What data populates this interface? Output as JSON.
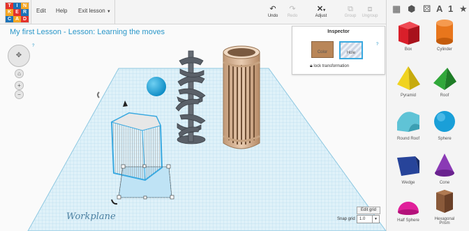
{
  "logo": {
    "letters": [
      "T",
      "I",
      "N",
      "K",
      "E",
      "R",
      "C",
      "A",
      "D"
    ]
  },
  "menu": {
    "edit": "Edit",
    "help": "Help",
    "exit_lesson": "Exit lesson"
  },
  "toolbar": {
    "undo": "Undo",
    "redo": "Redo",
    "adjust": "Adjust",
    "group": "Group",
    "ungroup": "Ungroup"
  },
  "lesson_title": "My first Lesson - Lesson: Learning the moves",
  "inspector": {
    "title": "Inspector",
    "color_label": "Color",
    "hole_label": "Hole",
    "lock_label": "lock transformation",
    "help": "?"
  },
  "view_controls": {
    "help": "?"
  },
  "sidebar_top": {
    "text_icon": "A",
    "number_icon": "1",
    "star_icon": "★"
  },
  "shapes": [
    {
      "label": "Box",
      "icon": "box-icon",
      "color": "#d91f2a"
    },
    {
      "label": "Cylinder",
      "icon": "cylinder-icon",
      "color": "#e8761c"
    },
    {
      "label": "Pyramid",
      "icon": "pyramid-icon",
      "color": "#f0d320"
    },
    {
      "label": "Roof",
      "icon": "roof-icon",
      "color": "#31a83a"
    },
    {
      "label": "Round Roof",
      "icon": "round-roof-icon",
      "color": "#5fc3d6"
    },
    {
      "label": "Sphere",
      "icon": "sphere-icon",
      "color": "#1a9fd8"
    },
    {
      "label": "Wedge",
      "icon": "wedge-icon",
      "color": "#27449a"
    },
    {
      "label": "Cone",
      "icon": "cone-icon",
      "color": "#8a3ab5"
    },
    {
      "label": "Half Sphere",
      "icon": "half-sphere-icon",
      "color": "#e0209a"
    },
    {
      "label": "Hexagonal Prism",
      "icon": "hexagonal-prism-icon",
      "color": "#8a5a3a"
    }
  ],
  "workplane": {
    "label": "Workplane",
    "edit_grid": "Edit grid",
    "snap_label": "Snap grid",
    "snap_value": "1.0"
  }
}
